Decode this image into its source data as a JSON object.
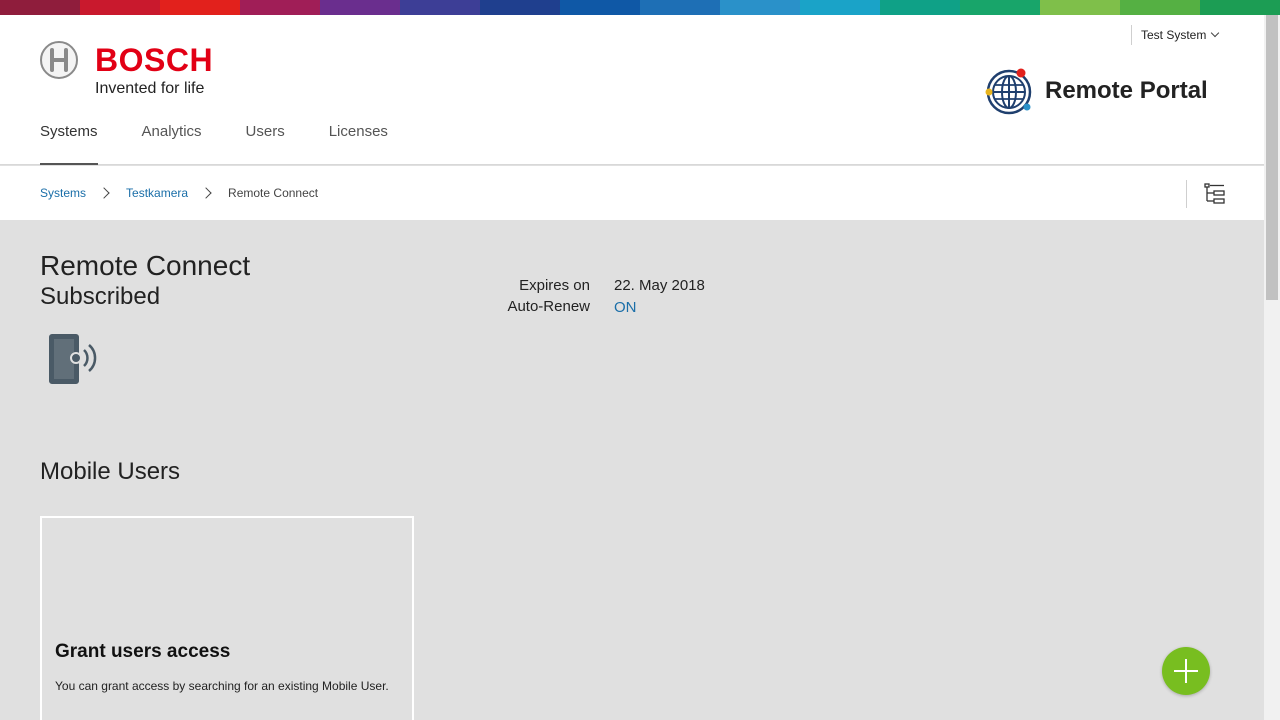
{
  "supergraphic_colors": [
    "#8f1d3c",
    "#c9192d",
    "#e2211c",
    "#a01e57",
    "#6a2e8e",
    "#3d3e96",
    "#1f3f8e",
    "#0f58a6",
    "#1e6fb5",
    "#2a91c9",
    "#1aa3c8",
    "#0fa187",
    "#18a56a",
    "#7fbf4a",
    "#55b043",
    "#1c9d54"
  ],
  "brand": {
    "name": "BOSCH",
    "tagline": "Invented for life",
    "red": "#e20015"
  },
  "system_menu": {
    "label": "Test System",
    "icon": "chevron-down-icon"
  },
  "portal": {
    "title": "Remote Portal",
    "icon": "globe-network-icon"
  },
  "nav": {
    "items": [
      {
        "label": "Systems",
        "active": true
      },
      {
        "label": "Analytics",
        "active": false
      },
      {
        "label": "Users",
        "active": false
      },
      {
        "label": "Licenses",
        "active": false
      }
    ]
  },
  "breadcrumb": {
    "items": [
      "Systems",
      "Testkamera"
    ],
    "current": "Remote Connect",
    "tree_icon": "tree-structure-icon"
  },
  "license": {
    "title": "Remote Connect",
    "status": "Subscribed",
    "device_icon": "mobile-signal-icon",
    "expires_label": "Expires on",
    "expires_value": "22. May 2018",
    "autorenew_label": "Auto-Renew",
    "autorenew_value": "ON"
  },
  "mobile_users": {
    "section_title": "Mobile Users",
    "card_title": "Grant users access",
    "card_text": "You can grant access by searching for an existing Mobile User."
  },
  "fab": {
    "icon": "plus-icon",
    "color": "#78be20"
  },
  "link_color": "#1a6ea8"
}
